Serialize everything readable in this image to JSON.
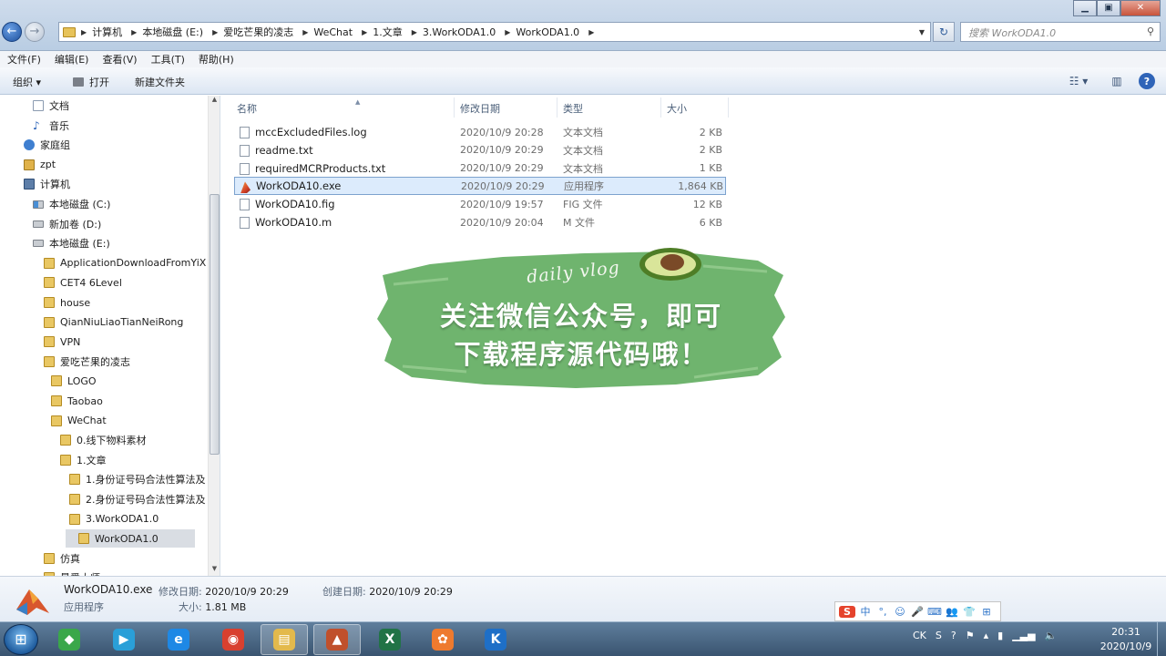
{
  "window": {
    "minimize": "▁",
    "maximize": "▣",
    "close": "✕"
  },
  "address": {
    "crumbs": [
      "计算机",
      "本地磁盘 (E:)",
      "爱吃芒果的凌志",
      "WeChat",
      "1.文章",
      "3.WorkODA1.0",
      "WorkODA1.0"
    ],
    "search_placeholder": "搜索 WorkODA1.0"
  },
  "menu": [
    "文件(F)",
    "编辑(E)",
    "查看(V)",
    "工具(T)",
    "帮助(H)"
  ],
  "toolbar": {
    "organize": "组织 ▾",
    "open": "打开",
    "new_folder": "新建文件夹",
    "view_icon": "☷ ▾",
    "preview_icon": "▥",
    "help_icon": "?"
  },
  "nav": [
    {
      "label": "文档",
      "indent": 2,
      "icon": "doc"
    },
    {
      "label": "音乐",
      "indent": 2,
      "icon": "music"
    },
    {
      "label": "家庭组",
      "indent": 1,
      "icon": "group"
    },
    {
      "label": "zpt",
      "indent": 1,
      "icon": "user"
    },
    {
      "label": "计算机",
      "indent": 1,
      "icon": "computer"
    },
    {
      "label": "本地磁盘 (C:)",
      "indent": 2,
      "icon": "drive-sys"
    },
    {
      "label": "新加卷 (D:)",
      "indent": 2,
      "icon": "drive"
    },
    {
      "label": "本地磁盘 (E:)",
      "indent": 2,
      "icon": "drive"
    },
    {
      "label": "ApplicationDownloadFromYiX",
      "indent": 3,
      "icon": "folder"
    },
    {
      "label": "CET4 6Level",
      "indent": 3,
      "icon": "folder"
    },
    {
      "label": "house",
      "indent": 3,
      "icon": "folder"
    },
    {
      "label": "QianNiuLiaoTianNeiRong",
      "indent": 3,
      "icon": "folder"
    },
    {
      "label": "VPN",
      "indent": 3,
      "icon": "folder"
    },
    {
      "label": "爱吃芒果的凌志",
      "indent": 3,
      "icon": "folder"
    },
    {
      "label": "LOGO",
      "indent": 4,
      "icon": "folder"
    },
    {
      "label": "Taobao",
      "indent": 4,
      "icon": "folder"
    },
    {
      "label": "WeChat",
      "indent": 4,
      "icon": "folder"
    },
    {
      "label": "0.线下物料素材",
      "indent": 5,
      "icon": "folder"
    },
    {
      "label": "1.文章",
      "indent": 5,
      "icon": "folder"
    },
    {
      "label": "1.身份证号码合法性算法及",
      "indent": 6,
      "icon": "folder"
    },
    {
      "label": "2.身份证号码合法性算法及",
      "indent": 6,
      "icon": "folder"
    },
    {
      "label": "3.WorkODA1.0",
      "indent": 6,
      "icon": "folder"
    },
    {
      "label": "WorkODA1.0",
      "indent": 7,
      "icon": "folder",
      "selected": true
    },
    {
      "label": "仿真",
      "indent": 3,
      "icon": "folder"
    },
    {
      "label": "最爱大师",
      "indent": 3,
      "icon": "folder"
    }
  ],
  "columns": {
    "name": "名称",
    "date": "修改日期",
    "type": "类型",
    "size": "大小"
  },
  "files": [
    {
      "name": "mccExcludedFiles.log",
      "date": "2020/10/9 20:28",
      "type": "文本文档",
      "size": "2 KB",
      "icon": "txt"
    },
    {
      "name": "readme.txt",
      "date": "2020/10/9 20:29",
      "type": "文本文档",
      "size": "2 KB",
      "icon": "txt"
    },
    {
      "name": "requiredMCRProducts.txt",
      "date": "2020/10/9 20:29",
      "type": "文本文档",
      "size": "1 KB",
      "icon": "txt"
    },
    {
      "name": "WorkODA10.exe",
      "date": "2020/10/9 20:29",
      "type": "应用程序",
      "size": "1,864 KB",
      "icon": "exe",
      "selected": true
    },
    {
      "name": "WorkODA10.fig",
      "date": "2020/10/9 19:57",
      "type": "FIG 文件",
      "size": "12 KB",
      "icon": "fig"
    },
    {
      "name": "WorkODA10.m",
      "date": "2020/10/9 20:04",
      "type": "M 文件",
      "size": "6 KB",
      "icon": "m"
    }
  ],
  "banner": {
    "vlog": "daily vlog",
    "line1": "关注微信公众号，即可",
    "line2": "下载程序源代码哦！"
  },
  "details": {
    "filename": "WorkODA10.exe",
    "modified_label": "修改日期:",
    "modified": "2020/10/9 20:29",
    "created_label": "创建日期:",
    "created": "2020/10/9 20:29",
    "type": "应用程序",
    "size_label": "大小:",
    "size": "1.81 MB"
  },
  "ime": [
    "S",
    "中",
    "°,",
    "☺",
    "🎤",
    "⌨",
    "👥",
    "👕",
    "⊞"
  ],
  "tray": {
    "lang": "CK",
    "clock_time": "20:31",
    "clock_date": "2020/10/9"
  },
  "taskbar_apps": [
    {
      "name": "360",
      "color": "#3aa74a",
      "glyph": "◆"
    },
    {
      "name": "player",
      "color": "#2a9fd8",
      "glyph": "▶"
    },
    {
      "name": "browser",
      "color": "#1e88e5",
      "glyph": "e"
    },
    {
      "name": "chrome",
      "color": "#d8402f",
      "glyph": "◉"
    },
    {
      "name": "explorer",
      "color": "#e3b94c",
      "glyph": "▤"
    },
    {
      "name": "matlab",
      "color": "#c0502c",
      "glyph": "▲"
    },
    {
      "name": "excel",
      "color": "#217346",
      "glyph": "X"
    },
    {
      "name": "app-orange",
      "color": "#ee7a2e",
      "glyph": "✿"
    },
    {
      "name": "app-k",
      "color": "#1e6fc7",
      "glyph": "K"
    }
  ]
}
